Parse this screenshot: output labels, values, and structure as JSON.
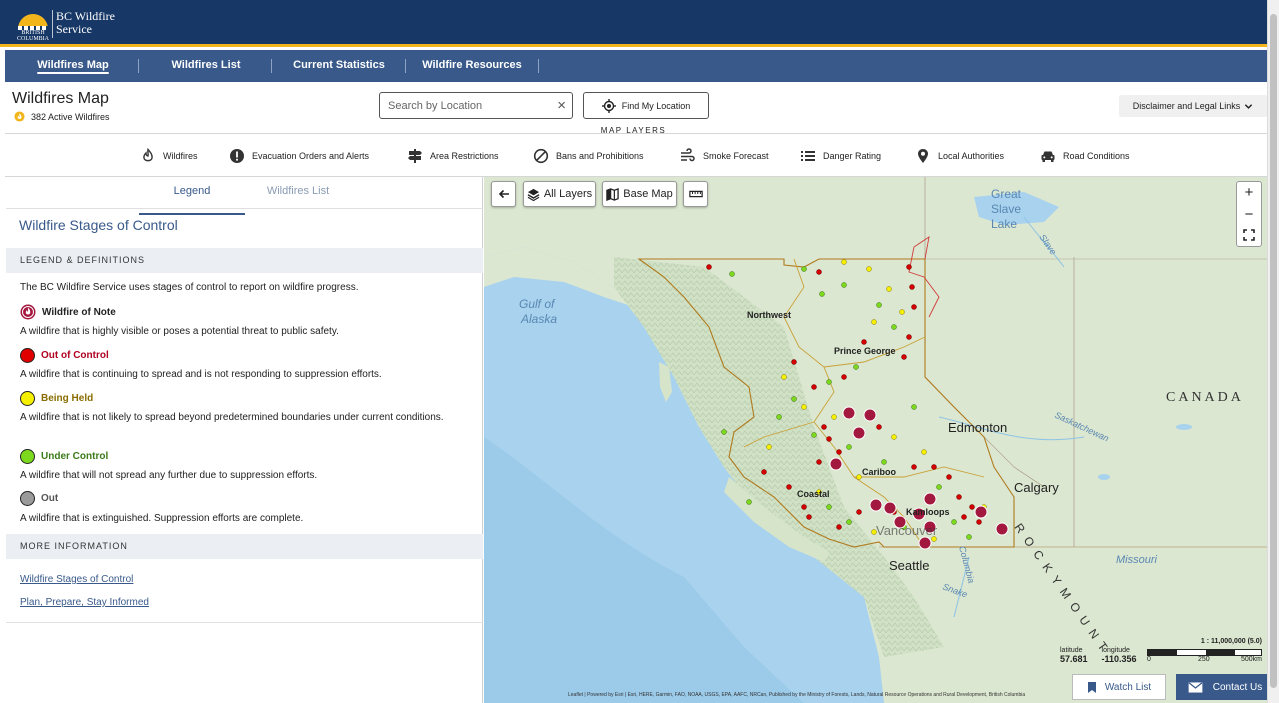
{
  "header": {
    "province_text": "BRITISH COLUMBIA",
    "brand_line1": "BC Wildfire",
    "brand_line2": "Service"
  },
  "nav": {
    "items": [
      {
        "label": "Wildfires Map",
        "active": true
      },
      {
        "label": "Wildfires List",
        "active": false
      },
      {
        "label": "Current Statistics",
        "active": false
      },
      {
        "label": "Wildfire Resources",
        "active": false
      }
    ]
  },
  "page": {
    "title": "Wildfires Map",
    "active_count": "382 Active Wildfires"
  },
  "search": {
    "placeholder": "Search by Location",
    "value": ""
  },
  "find_my_location": "Find My Location",
  "disclaimer": "Disclaimer and Legal Links",
  "map_layers": {
    "title": "MAP LAYERS",
    "items": [
      {
        "label": "Wildfires",
        "icon": "flame-icon"
      },
      {
        "label": "Evacuation Orders and Alerts",
        "icon": "alert-icon"
      },
      {
        "label": "Area Restrictions",
        "icon": "signpost-icon"
      },
      {
        "label": "Bans and Prohibitions",
        "icon": "ban-icon"
      },
      {
        "label": "Smoke Forecast",
        "icon": "smoke-icon"
      },
      {
        "label": "Danger Rating",
        "icon": "list-icon"
      },
      {
        "label": "Local Authorities",
        "icon": "location-pin-icon"
      },
      {
        "label": "Road Conditions",
        "icon": "car-icon"
      }
    ]
  },
  "panel": {
    "tabs": [
      {
        "label": "Legend",
        "active": true
      },
      {
        "label": "Wildfires List",
        "active": false
      }
    ],
    "title": "Wildfire Stages of Control",
    "legend_heading": "LEGEND & DEFINITIONS",
    "intro": "The BC Wildfire Service uses stages of control to report on wildfire progress.",
    "stages": [
      {
        "label": "Wildfire of Note",
        "desc": "A wildfire that is highly visible or poses a potential threat to public safety.",
        "color": "#a3183f",
        "text_color": "#222222"
      },
      {
        "label": "Out of Control",
        "desc": "A wildfire that is continuing to spread and is not responding to suppression efforts.",
        "color": "#e00000",
        "text_color": "#b00020"
      },
      {
        "label": "Being Held",
        "desc": "A wildfire that is not likely to spread beyond predetermined boundaries under current conditions.",
        "color": "#f5f000",
        "text_color": "#8a6d00"
      },
      {
        "label": "Under Control",
        "desc": "A wildfire that will not spread any further due to suppression efforts.",
        "color": "#7cd91e",
        "text_color": "#3a7a1a"
      },
      {
        "label": "Out",
        "desc": "A wildfire that is extinguished. Suppression efforts are complete.",
        "color": "#9a9a9a",
        "text_color": "#555555"
      }
    ],
    "more_info_heading": "MORE INFORMATION",
    "links": [
      "Wildfire Stages of Control",
      "Plan, Prepare, Stay Informed"
    ]
  },
  "map": {
    "controls": {
      "back": "back",
      "all_layers": "All Layers",
      "base_map": "Base Map",
      "zoom_in": "+",
      "zoom_out": "−"
    },
    "labels": {
      "gulf": "Gulf of",
      "alaska": "Alaska",
      "great": "Great",
      "slave": "Slave",
      "lake": "Lake",
      "slave_river": "Slave",
      "canada": "CANADA",
      "edmonton": "Edmonton",
      "calgary": "Calgary",
      "saskatchewan": "Saskatchewan",
      "seattle": "Seattle",
      "vancouver": "Vancouver",
      "missouri": "Missouri",
      "snake": "Snake",
      "rocky": "R O C K Y   M O U N T",
      "columbia": "Columbia",
      "northwest": "Northwest",
      "prince_george": "Prince George",
      "cariboo": "Cariboo",
      "coastal": "Coastal",
      "kamloops": "Kamloops"
    },
    "latitude_label": "latitude",
    "latitude": "57.681",
    "longitude_label": "longitude",
    "longitude": "-110.356",
    "scale_ratio": "1 : 11,000,000 (5.0)",
    "scale_ticks": [
      "0",
      "250",
      "500km"
    ],
    "attribution": "Leaflet | Powered by Esri | Esri, HERE, Garmin, FAO, NOAA, USGS, EPA, AAFC, NRCan, Published by the Ministry of Forests, Lands, Natural Resource Operations and Rural Development, British Columbia",
    "watch_list": "Watch List",
    "contact_us": "Contact Us"
  }
}
